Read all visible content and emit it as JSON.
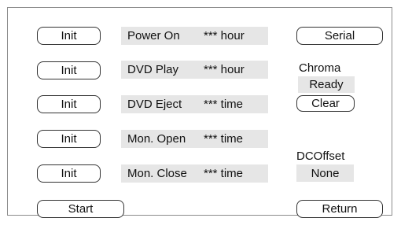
{
  "init_buttons": [
    "Init",
    "Init",
    "Init",
    "Init",
    "Init"
  ],
  "counters": [
    {
      "label": "Power On",
      "value": "*** hour"
    },
    {
      "label": "DVD Play",
      "value": "*** hour"
    },
    {
      "label": "DVD Eject",
      "value": "*** time"
    },
    {
      "label": "Mon. Open",
      "value": "*** time"
    },
    {
      "label": "Mon. Close",
      "value": "*** time"
    }
  ],
  "right": {
    "serial_label": "Serial",
    "chroma_title": "Chroma",
    "chroma_status": "Ready",
    "clear_label": "Clear",
    "dcoffset_title": "DCOffset",
    "dcoffset_status": "None",
    "return_label": "Return"
  },
  "start_label": "Start"
}
